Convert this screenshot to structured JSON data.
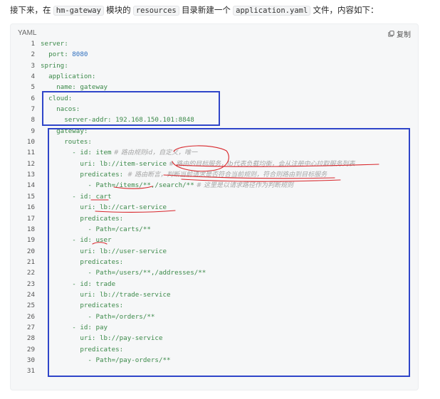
{
  "intro": {
    "p1": "接下来，在",
    "c1": "hm-gateway",
    "p2": "模块的",
    "c2": "resources",
    "p3": "目录新建一个",
    "c3": "application.yaml",
    "p4": "文件，内容如下："
  },
  "code_block": {
    "language": "YAML",
    "copy_label": "复制",
    "lines": [
      {
        "n": "1",
        "key": "server:",
        "val": "",
        "comment": ""
      },
      {
        "n": "2",
        "key": "  port: ",
        "val": "8080",
        "comment": ""
      },
      {
        "n": "3",
        "key": "spring:",
        "val": "",
        "comment": ""
      },
      {
        "n": "4",
        "key": "  application:",
        "val": "",
        "comment": ""
      },
      {
        "n": "5",
        "key": "    name: ",
        "val": "gateway",
        "comment": ""
      },
      {
        "n": "6",
        "key": "  cloud:",
        "val": "",
        "comment": ""
      },
      {
        "n": "7",
        "key": "    nacos:",
        "val": "",
        "comment": ""
      },
      {
        "n": "8",
        "key": "      server-addr: ",
        "val": "192.168.150.101:8848",
        "comment": ""
      },
      {
        "n": "9",
        "key": "    gateway:",
        "val": "",
        "comment": ""
      },
      {
        "n": "10",
        "key": "      routes:",
        "val": "",
        "comment": ""
      },
      {
        "n": "11",
        "key": "        - id: ",
        "val": "item",
        "comment": " # 路由规则id，自定义，唯一"
      },
      {
        "n": "12",
        "key": "          uri: ",
        "val": "lb://item-service",
        "comment": " # 路由的目标服务，lb代表负载均衡，会从注册中心拉取服务列表"
      },
      {
        "n": "13",
        "key": "          predicates: ",
        "val": "",
        "comment": "# 路由断言，判断当前请求是否符合当前规则，符合则路由到目标服务"
      },
      {
        "n": "14",
        "key": "            - ",
        "val": "Path=/items/**,/search/**",
        "comment": " # 这里是以请求路径作为判断规则"
      },
      {
        "n": "15",
        "key": "        - id: ",
        "val": "cart",
        "comment": ""
      },
      {
        "n": "16",
        "key": "          uri: ",
        "val": "lb://cart-service",
        "comment": ""
      },
      {
        "n": "17",
        "key": "          predicates:",
        "val": "",
        "comment": ""
      },
      {
        "n": "18",
        "key": "            - ",
        "val": "Path=/carts/**",
        "comment": ""
      },
      {
        "n": "19",
        "key": "        - id: ",
        "val": "user",
        "comment": ""
      },
      {
        "n": "20",
        "key": "          uri: ",
        "val": "lb://user-service",
        "comment": ""
      },
      {
        "n": "21",
        "key": "          predicates:",
        "val": "",
        "comment": ""
      },
      {
        "n": "22",
        "key": "            - ",
        "val": "Path=/users/**,/addresses/**",
        "comment": ""
      },
      {
        "n": "23",
        "key": "        - id: ",
        "val": "trade",
        "comment": ""
      },
      {
        "n": "24",
        "key": "          uri: ",
        "val": "lb://trade-service",
        "comment": ""
      },
      {
        "n": "25",
        "key": "          predicates:",
        "val": "",
        "comment": ""
      },
      {
        "n": "26",
        "key": "            - ",
        "val": "Path=/orders/**",
        "comment": ""
      },
      {
        "n": "27",
        "key": "        - id: ",
        "val": "pay",
        "comment": ""
      },
      {
        "n": "28",
        "key": "          uri: ",
        "val": "lb://pay-service",
        "comment": ""
      },
      {
        "n": "29",
        "key": "          predicates:",
        "val": "",
        "comment": ""
      },
      {
        "n": "30",
        "key": "            - ",
        "val": "Path=/pay-orders/**",
        "comment": ""
      },
      {
        "n": "31",
        "key": "",
        "val": "",
        "comment": ""
      }
    ]
  },
  "annotations": {
    "box_color": "#2f45c9",
    "ink_color": "#d8262b"
  },
  "icons": [
    "copy-icon"
  ]
}
